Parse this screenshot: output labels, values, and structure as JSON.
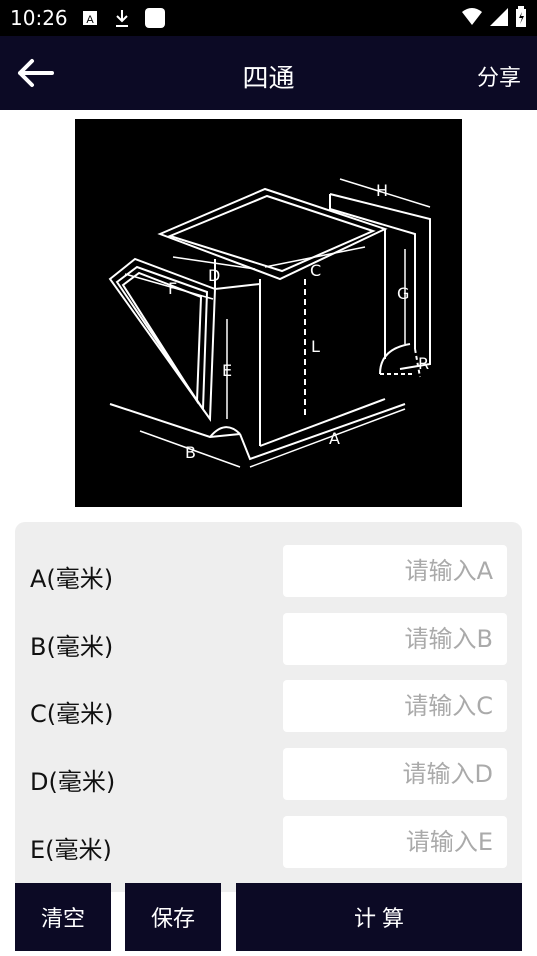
{
  "status": {
    "time": "10:26"
  },
  "header": {
    "title": "四通",
    "share": "分享"
  },
  "fields": [
    {
      "label": "A(毫米)",
      "placeholder": "请输入A"
    },
    {
      "label": "B(毫米)",
      "placeholder": "请输入B"
    },
    {
      "label": "C(毫米)",
      "placeholder": "请输入C"
    },
    {
      "label": "D(毫米)",
      "placeholder": "请输入D"
    },
    {
      "label": "E(毫米)",
      "placeholder": "请输入E"
    }
  ],
  "diagram_labels": {
    "A": "A",
    "B": "B",
    "C": "C",
    "D": "D",
    "E": "E",
    "F": "F",
    "G": "G",
    "H": "H",
    "L": "L",
    "R": "R"
  },
  "buttons": {
    "clear": "清空",
    "save": "保存",
    "calc": "计 算"
  }
}
